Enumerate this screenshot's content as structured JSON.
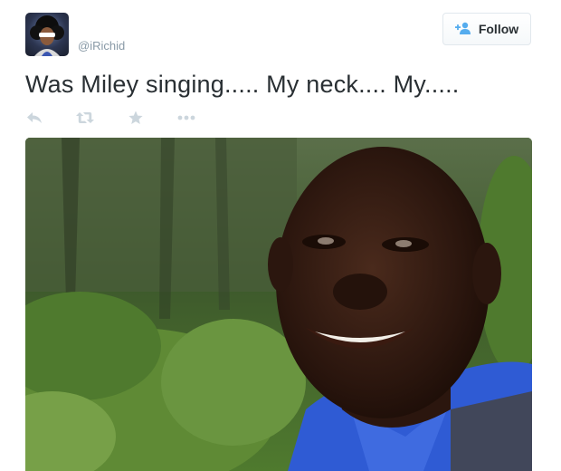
{
  "user": {
    "handle": "@iRichid",
    "avatar_icon": "profile-avatar"
  },
  "follow_button": {
    "label": "Follow",
    "icon": "add-user-icon",
    "accent": "#55acee"
  },
  "tweet": {
    "text": "Was Miley singing..... My neck.... My....."
  },
  "actions": [
    {
      "icon": "reply-icon"
    },
    {
      "icon": "retweet-icon"
    },
    {
      "icon": "favorite-star-icon"
    },
    {
      "icon": "more-dots-icon"
    }
  ],
  "colors": {
    "muted": "#8899a6",
    "text": "#292f33",
    "action_icon": "#ccd6dd"
  }
}
